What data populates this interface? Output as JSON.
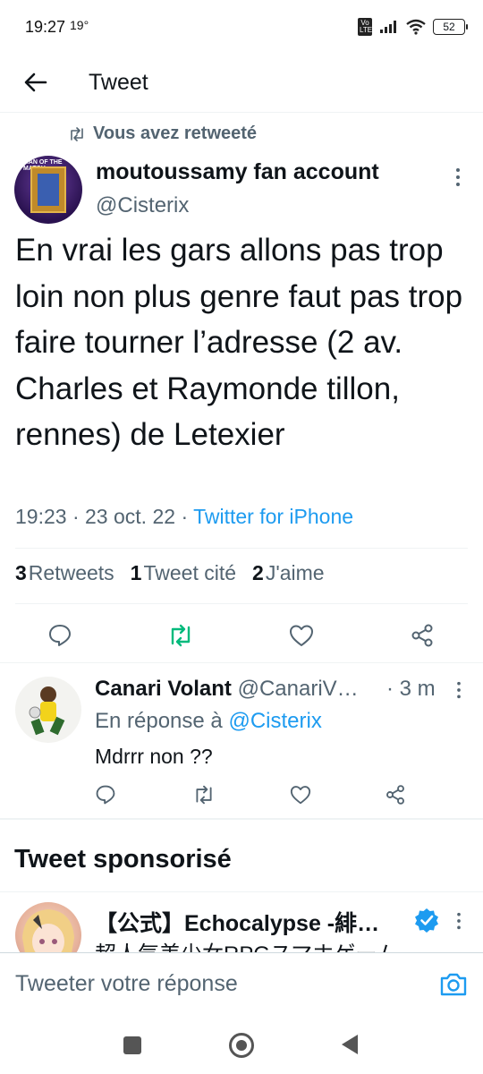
{
  "status_bar": {
    "time": "19:27",
    "extra": "19°",
    "volte": "Vo LTE",
    "battery": "52"
  },
  "header": {
    "title": "Tweet"
  },
  "main_tweet": {
    "retweet_notice": "Vous avez retweeté",
    "author_name": "moutoussamy fan account",
    "author_handle": "@Cisterix",
    "text": "En vrai les gars allons pas trop loin non plus genre faut pas trop faire tourner l’adresse (2 av. Charles et Raymonde tillon, rennes) de Letexier",
    "time": "19:23",
    "date": "23 oct. 22",
    "source": "Twitter for iPhone",
    "stats": {
      "retweets_count": "3",
      "retweets_label": "Retweets",
      "quotes_count": "1",
      "quotes_label": "Tweet cité",
      "likes_count": "2",
      "likes_label": "J'aime"
    },
    "avatar_text": "MAN OF THE MATCH"
  },
  "reply": {
    "author_name": "Canari Volant",
    "author_handle": "@CanariV…",
    "time": "· 3 m",
    "reply_to_label": "En réponse à",
    "reply_to_handle": "@Cisterix",
    "text": "Mdrrr non ??"
  },
  "sponsored": {
    "section_title": "Tweet sponsorisé",
    "author_name": "【公式】Echocalypse -緋…",
    "text": "超人気美少女RPGスマホゲーム"
  },
  "composer": {
    "placeholder": "Tweeter votre réponse"
  },
  "colors": {
    "accent": "#1d9bf0",
    "retweet_green": "#00ba7c",
    "secondary_text": "#536471"
  }
}
